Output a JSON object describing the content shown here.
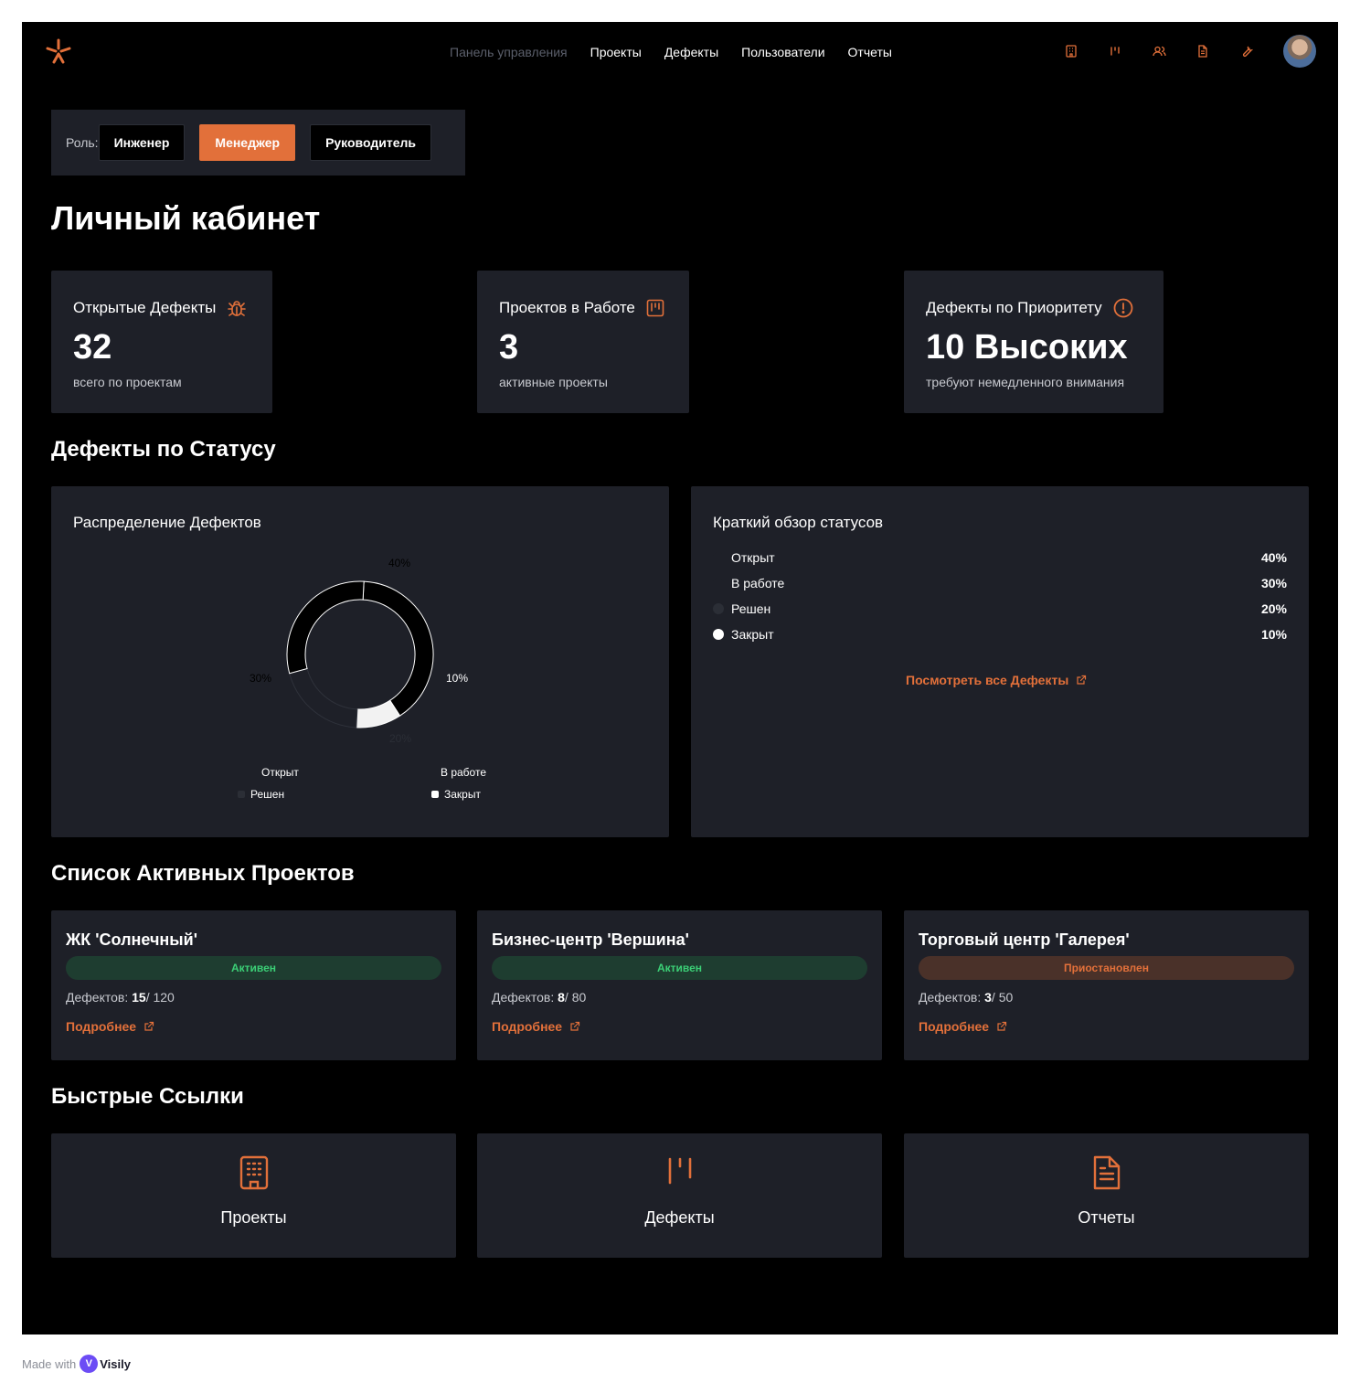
{
  "nav": {
    "items": [
      "Панель управления",
      "Проекты",
      "Дефекты",
      "Пользователи",
      "Отчеты"
    ]
  },
  "header_icons": [
    "building-icon",
    "kanban-icon",
    "users-icon",
    "document-icon",
    "wrench-icon"
  ],
  "roles": {
    "label": "Роль:",
    "options": [
      "Инженер",
      "Менеджер",
      "Руководитель"
    ],
    "active": "Менеджер"
  },
  "page_title": "Личный кабинет",
  "stats": [
    {
      "title": "Открытые Дефекты",
      "value": "32",
      "sub": "всего по проектам",
      "icon": "bug-icon"
    },
    {
      "title": "Проектов в Работе",
      "value": "3",
      "sub": "активные проекты",
      "icon": "kanban-icon"
    },
    {
      "title": "Дефекты по Приоритету",
      "value": "10 Высоких",
      "sub": "требуют немедленного внимания",
      "icon": "alert-circle-icon"
    }
  ],
  "status_section": {
    "title": "Дефекты по Статусу"
  },
  "chart_panel": {
    "title": "Распределение Дефектов"
  },
  "chart_data": {
    "type": "pie",
    "categories": [
      "Открыт",
      "В работе",
      "Решен",
      "Закрыт"
    ],
    "values": [
      40,
      30,
      20,
      10
    ],
    "labels": [
      "40%",
      "30%",
      "20%",
      "10%"
    ],
    "colors": [
      "#000000",
      "#000000",
      "#1e2028",
      "#f2f2f2"
    ],
    "legend_placement": "bottom"
  },
  "summary_panel": {
    "title": "Краткий обзор статусов",
    "rows": [
      {
        "label": "Открыт",
        "value": "40%",
        "color": "#1e2028"
      },
      {
        "label": "В работе",
        "value": "30%",
        "color": "#1e2028"
      },
      {
        "label": "Решен",
        "value": "20%",
        "color": "#2b2e36"
      },
      {
        "label": "Закрыт",
        "value": "10%",
        "color": "#ffffff"
      }
    ],
    "link": "Посмотреть все Дефекты"
  },
  "projects_section": {
    "title": "Список Активных Проектов"
  },
  "projects": [
    {
      "name": "ЖК 'Солнечный'",
      "status": "Активен",
      "count_label": "Дефектов:",
      "count": "15",
      "total": "/ 120",
      "link": "Подробнее"
    },
    {
      "name": "Бизнес-центр 'Вершина'",
      "status": "Активен",
      "count_label": "Дефектов:",
      "count": "8",
      "total": "/ 80",
      "link": "Подробнее"
    },
    {
      "name": "Торговый центр 'Галерея'",
      "status": "Приостановлен",
      "count_label": "Дефектов:",
      "count": "3",
      "total": "/ 50",
      "link": "Подробнее"
    }
  ],
  "quick_links_section": {
    "title": "Быстрые Ссылки"
  },
  "quick_links": [
    {
      "label": "Проекты",
      "icon": "building-icon"
    },
    {
      "label": "Дефекты",
      "icon": "kanban-icon"
    },
    {
      "label": "Отчеты",
      "icon": "document-icon"
    }
  ],
  "footer": {
    "made_with": "Made with",
    "brand": "Visily"
  },
  "colors": {
    "accent": "#e2703a",
    "card": "#1e2028",
    "active_badge": "#3bcf76"
  }
}
